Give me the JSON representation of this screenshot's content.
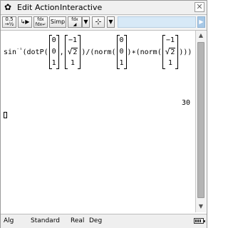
{
  "menubar": {
    "gear_icon": "gear-icon",
    "items": [
      "Edit",
      "Action",
      "Interactive"
    ],
    "close_glyph": "✕"
  },
  "toolbar": {
    "buttons": [
      {
        "name": "fraction-decimal-toggle",
        "label": "0.5 ⇄ 1/2"
      },
      {
        "name": "graph-drag",
        "label": "↳▶"
      },
      {
        "name": "diff-tool",
        "label": "fdx↵ fdx↵"
      },
      {
        "name": "simp",
        "label": "Simp"
      },
      {
        "name": "integral-tool",
        "label": "fdx ▾"
      },
      {
        "name": "dropdown-1",
        "label": "▼"
      },
      {
        "name": "graph-axes",
        "label": "┳"
      },
      {
        "name": "dropdown-2",
        "label": "▼"
      }
    ]
  },
  "work": {
    "expression": {
      "prefix": "sin",
      "sup": "⁻¹",
      "part1": "(dotP(",
      "vec_a": [
        "0",
        "0",
        "1"
      ],
      "comma": ",",
      "vec_b_top": "−1",
      "vec_b_mid": "2",
      "vec_b_bot": "1",
      "part2": ")/(norm(",
      "vec_c": [
        "0",
        "0",
        "1"
      ],
      "part3": ")∗(norm(",
      "vec_d_top": "−1",
      "vec_d_mid": "2",
      "vec_d_bot": "1",
      "part4": ")))"
    },
    "result": "30"
  },
  "statusbar": {
    "items": [
      "Alg",
      "Standard",
      "Real",
      "Deg"
    ]
  }
}
